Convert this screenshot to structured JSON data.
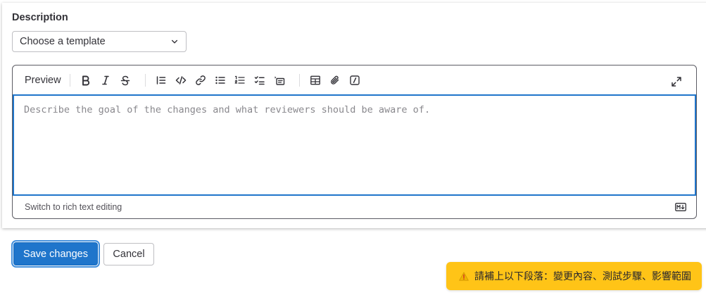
{
  "description": {
    "label": "Description",
    "template_select": {
      "value": "Choose a template"
    }
  },
  "editor": {
    "preview_label": "Preview",
    "toolbar_icons": [
      "bold-icon",
      "italic-icon",
      "strikethrough-icon",
      "quote-icon",
      "code-icon",
      "link-icon",
      "bullet-list-icon",
      "numbered-list-icon",
      "task-list-icon",
      "collapsible-section-icon",
      "table-icon",
      "attach-file-icon",
      "slash-command-icon",
      "fullscreen-icon"
    ],
    "textarea": {
      "value": "",
      "placeholder": "Describe the goal of the changes and what reviewers should be aware of."
    },
    "switch_label": "Switch to rich text editing",
    "markdown_badge": "markdown-icon"
  },
  "actions": {
    "save_label": "Save changes",
    "cancel_label": "Cancel"
  },
  "toast": {
    "icon": "warning-icon",
    "message": "請補上以下段落：變更內容、測試步驟、影響範圍"
  },
  "colors": {
    "primary": "#1f75cb",
    "focus_border": "#1f75cb",
    "toast_bg": "#ffc417",
    "text": "#333238"
  }
}
